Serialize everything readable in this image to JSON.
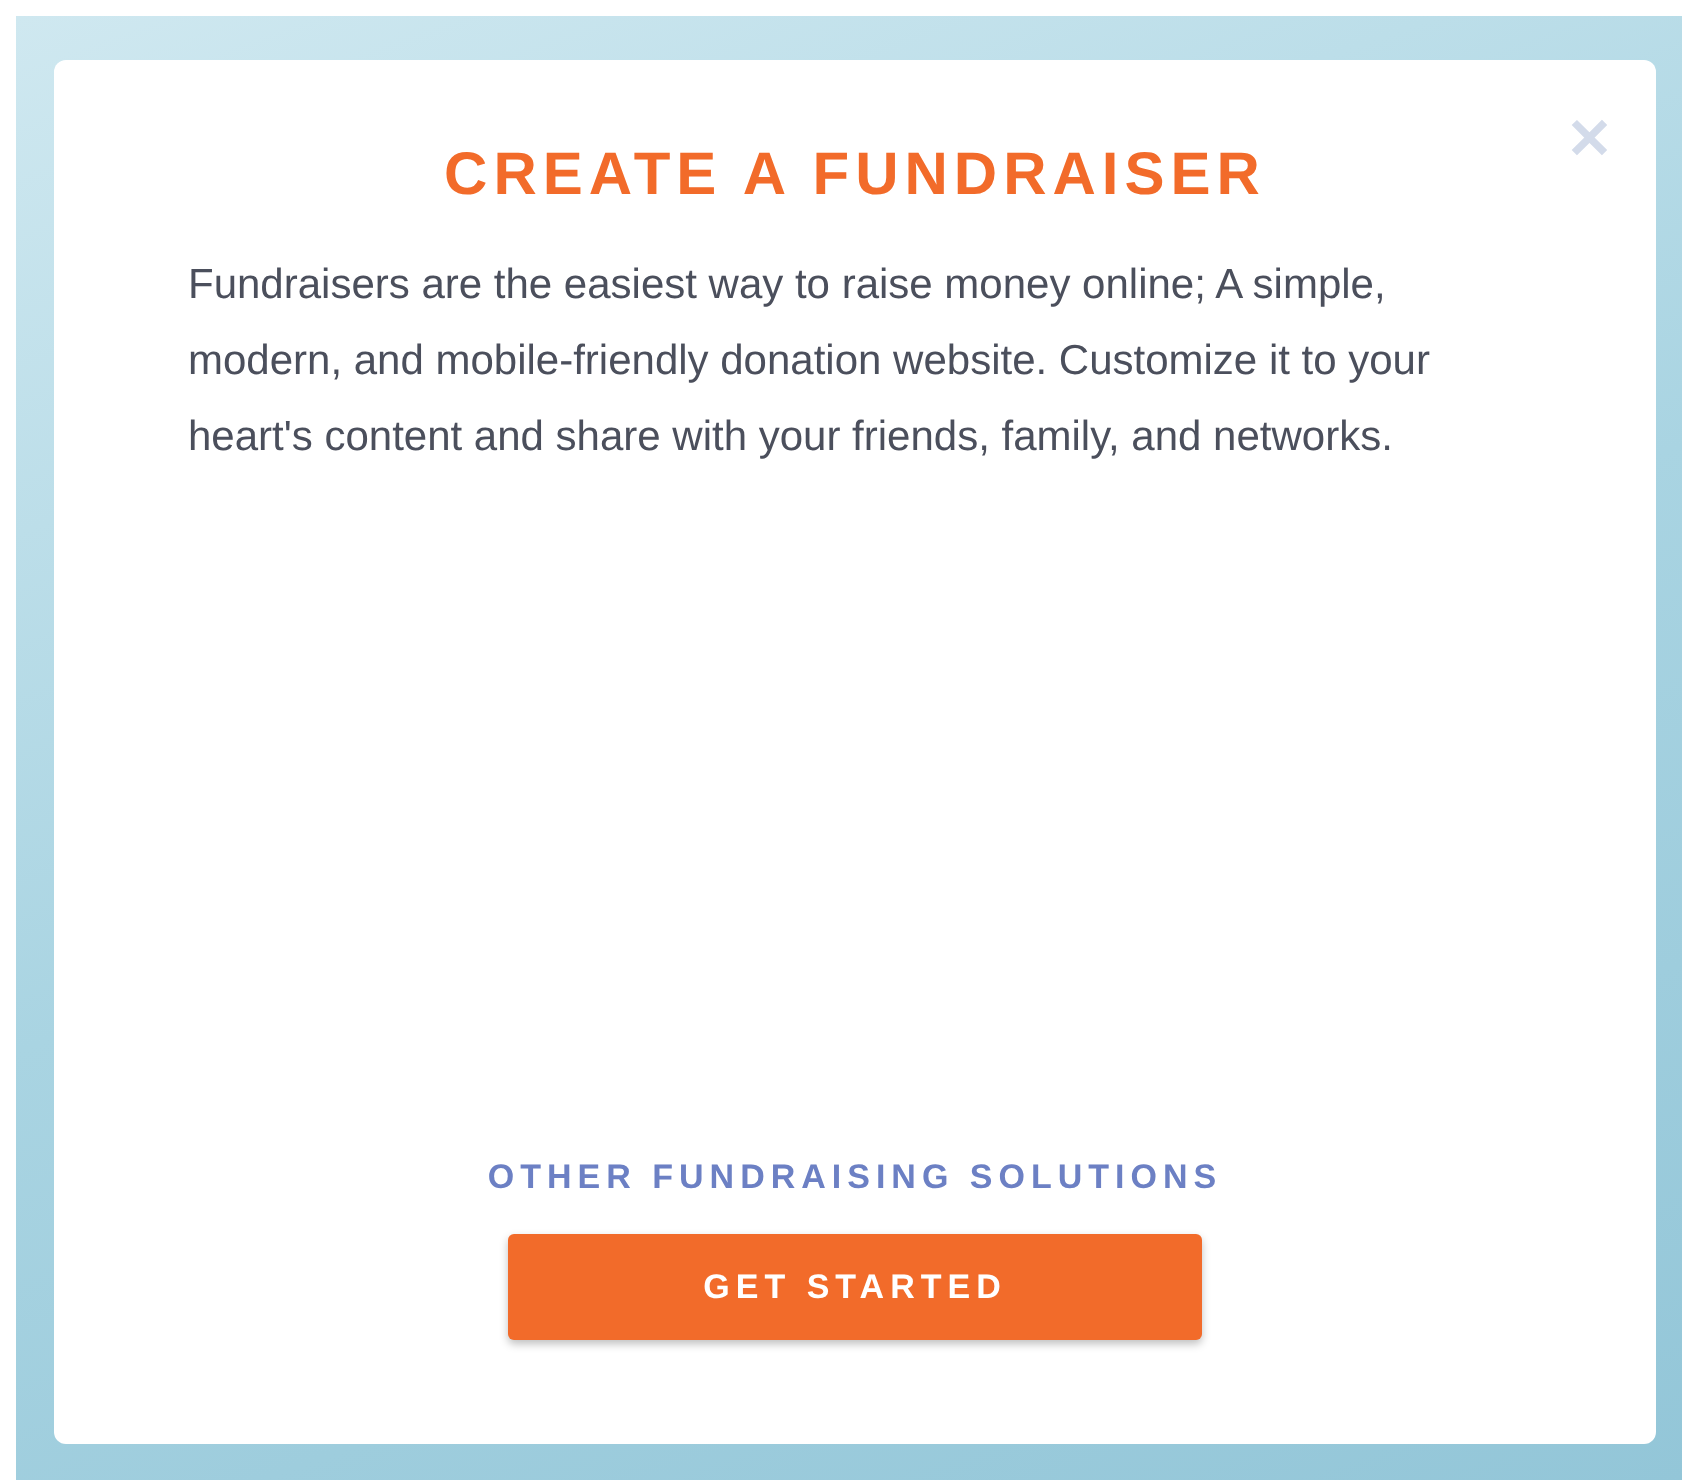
{
  "modal": {
    "title": "CREATE A FUNDRAISER",
    "close": "✕",
    "description": "Fundraisers are the easiest way to raise money online; A simple, modern, and mobile-friendly donation website. Customize it to your heart's content and share with your friends, family, and networks.",
    "link": "OTHER FUNDRAISING SOLUTIONS",
    "button": "GET STARTED"
  }
}
